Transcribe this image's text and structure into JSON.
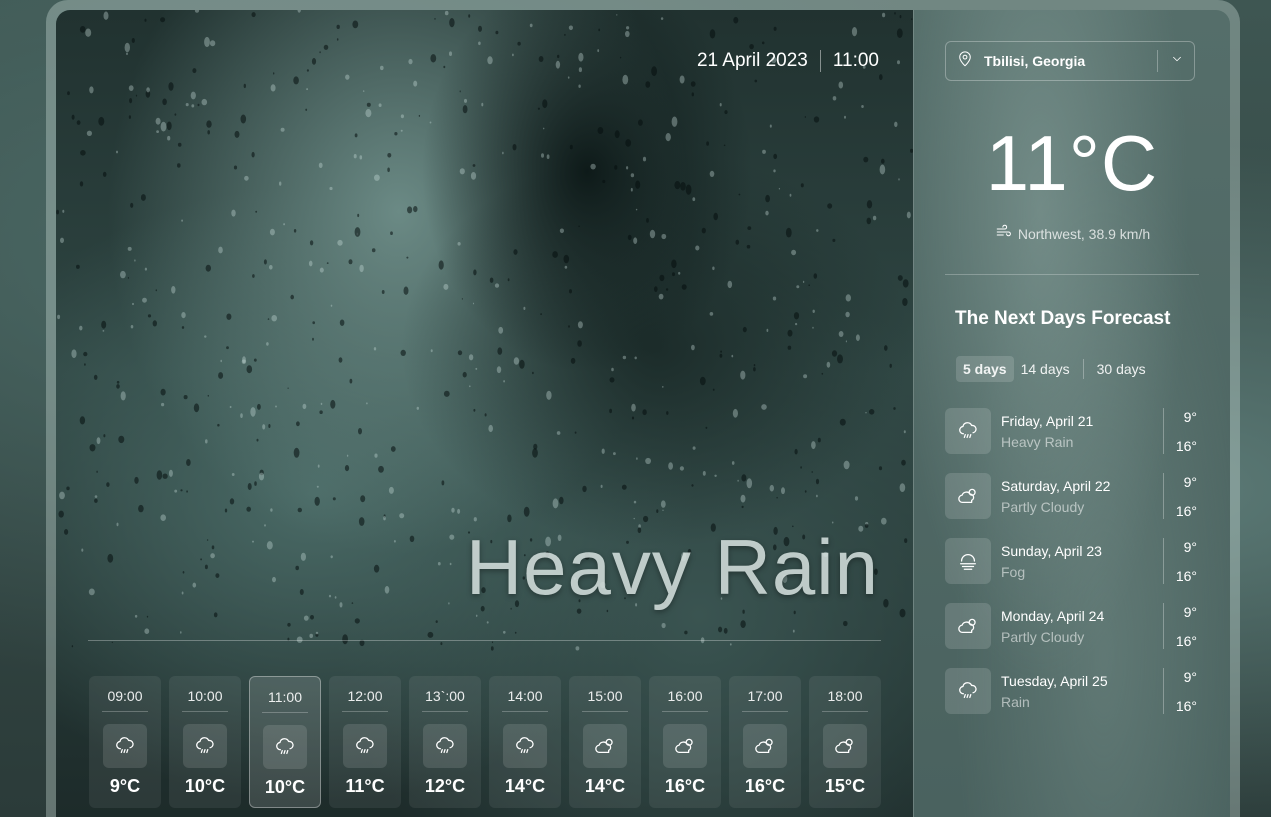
{
  "header": {
    "date": "21 April 2023",
    "time": "11:00"
  },
  "current": {
    "condition": "Heavy Rain",
    "temperature": "11°C",
    "wind": "Northwest, 38.9 km/h",
    "location": "Tbilisi, Georgia"
  },
  "hourly": [
    {
      "time": "09:00",
      "temp": "9°C",
      "icon": "rain-cloud-icon"
    },
    {
      "time": "10:00",
      "temp": "10°C",
      "icon": "rain-cloud-icon"
    },
    {
      "time": "11:00",
      "temp": "10°C",
      "icon": "rain-cloud-icon"
    },
    {
      "time": "12:00",
      "temp": "11°C",
      "icon": "rain-cloud-icon"
    },
    {
      "time": "13`:00",
      "temp": "12°C",
      "icon": "rain-cloud-icon"
    },
    {
      "time": "14:00",
      "temp": "14°C",
      "icon": "rain-cloud-icon"
    },
    {
      "time": "15:00",
      "temp": "14°C",
      "icon": "partly-cloudy-icon"
    },
    {
      "time": "16:00",
      "temp": "16°C",
      "icon": "partly-cloudy-icon"
    },
    {
      "time": "17:00",
      "temp": "16°C",
      "icon": "partly-cloudy-icon"
    },
    {
      "time": "18:00",
      "temp": "15°C",
      "icon": "partly-cloudy-icon"
    }
  ],
  "forecast": {
    "title": "The Next Days Forecast",
    "tabs": [
      "5 days",
      "14 days",
      "30 days"
    ],
    "days": [
      {
        "name": "Friday, April 21",
        "condition": "Heavy Rain",
        "low": "9°",
        "high": "16°",
        "icon": "rain-cloud-icon"
      },
      {
        "name": "Saturday, April 22",
        "condition": "Partly Cloudy",
        "low": "9°",
        "high": "16°",
        "icon": "partly-cloudy-icon"
      },
      {
        "name": "Sunday, April 23",
        "condition": "Fog",
        "low": "9°",
        "high": "16°",
        "icon": "fog-icon"
      },
      {
        "name": "Monday, April 24",
        "condition": "Partly Cloudy",
        "low": "9°",
        "high": "16°",
        "icon": "partly-cloudy-icon"
      },
      {
        "name": "Tuesday, April 25",
        "condition": "Rain",
        "low": "9°",
        "high": "16°",
        "icon": "rain-cloud-icon"
      }
    ]
  }
}
